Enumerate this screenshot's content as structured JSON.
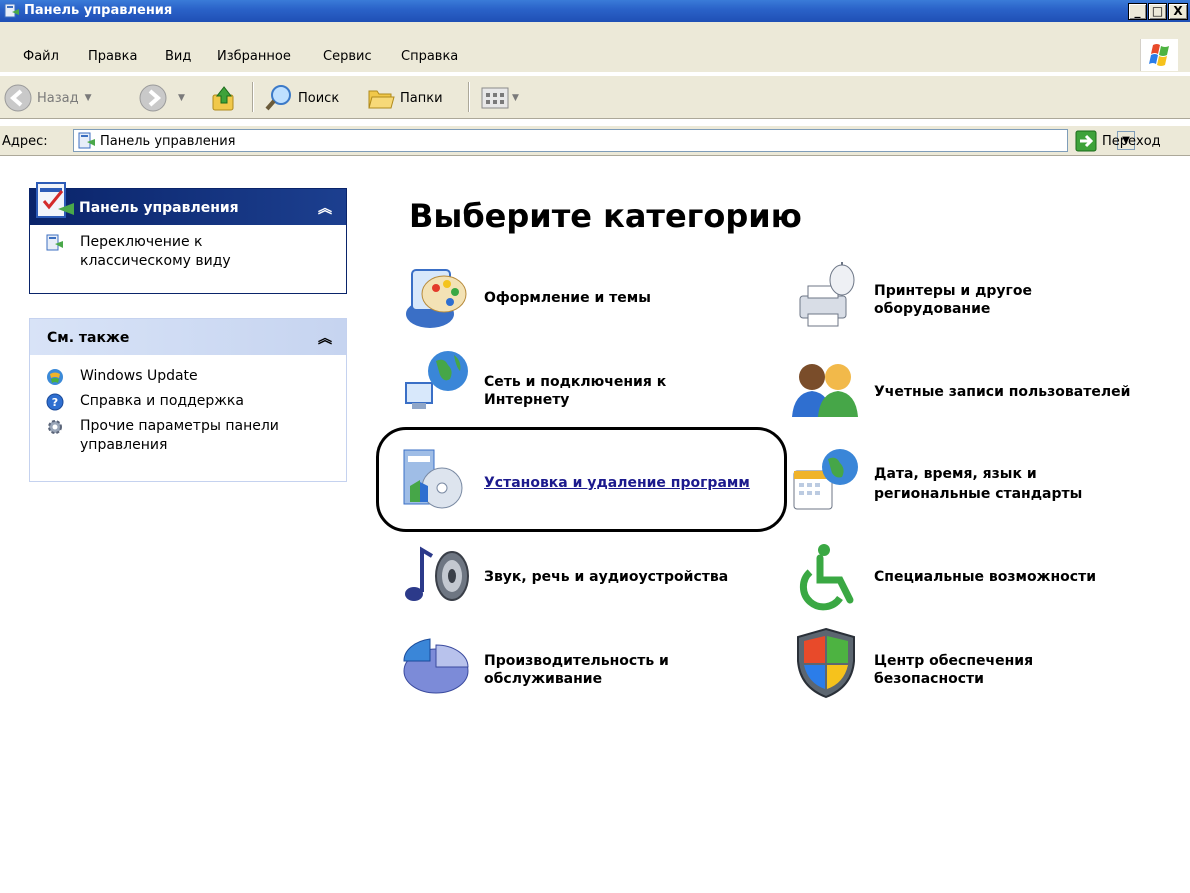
{
  "window": {
    "title": "Панель управления",
    "minimize": "_",
    "maximize": "□",
    "close": "X"
  },
  "menu": [
    "Файл",
    "Правка",
    "Вид",
    "Избранное",
    "Сервис",
    "Справка"
  ],
  "toolbar": {
    "back": "Назад",
    "search": "Поиск",
    "folders": "Папки"
  },
  "address": {
    "label": "Адрес:",
    "value": "Панель управления",
    "go": "Переход"
  },
  "sidebar": {
    "panel1": {
      "title": "Панель управления",
      "links": [
        "Переключение к классическому виду"
      ]
    },
    "panel2": {
      "title": "См. также",
      "links": [
        "Windows Update",
        "Справка и поддержка",
        "Прочие параметры панели управления"
      ]
    }
  },
  "main": {
    "heading": "Выберите категорию",
    "categories": [
      {
        "label1": "Оформление и темы",
        "label2": ""
      },
      {
        "label1": "Принтеры и другое",
        "label2": "оборудование"
      },
      {
        "label1": "Сеть и подключения к",
        "label2": "Интернету"
      },
      {
        "label1": "Учетные записи пользователей",
        "label2": ""
      },
      {
        "label1": "Установка и удаление программ",
        "label2": ""
      },
      {
        "label1": "Дата, время, язык и",
        "label2": "региональные стандарты"
      },
      {
        "label1": "Звук, речь и аудиоустройства",
        "label2": ""
      },
      {
        "label1": "Специальные возможности",
        "label2": ""
      },
      {
        "label1": "Производительность и",
        "label2": "обслуживание"
      },
      {
        "label1": "Центр обеспечения",
        "label2": "безопасности"
      }
    ]
  },
  "colors": {
    "titlebar": "#2b63c9",
    "panel_header": "#0a246a",
    "link_active": "#1c1a8d"
  }
}
